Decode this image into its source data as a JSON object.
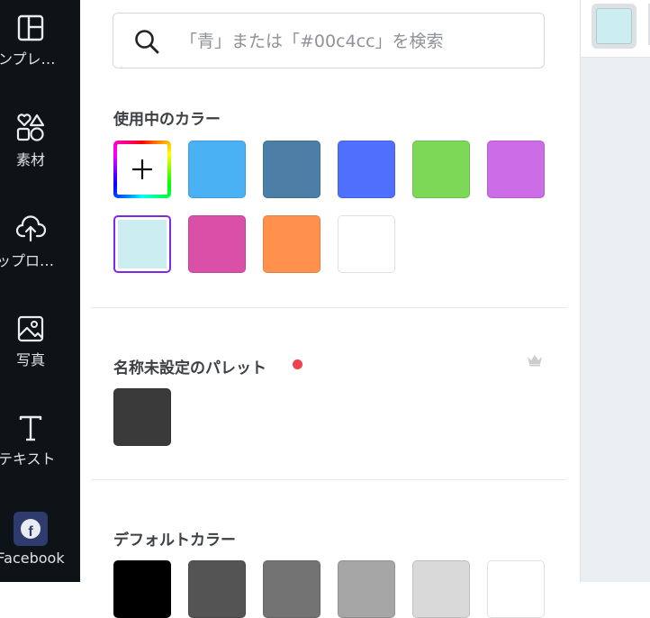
{
  "sidebar": {
    "items": [
      {
        "key": "templates",
        "label": "ンプレ…",
        "icon": "templates-icon"
      },
      {
        "key": "elements",
        "label": "素材",
        "icon": "shapes-icon"
      },
      {
        "key": "uploads",
        "label": "ップロ…",
        "icon": "cloud-upload-icon"
      },
      {
        "key": "photos",
        "label": "写真",
        "icon": "image-icon"
      },
      {
        "key": "text",
        "label": "テキスト",
        "icon": "text-icon"
      },
      {
        "key": "facebook",
        "label": "Facebook",
        "icon": "facebook-icon"
      }
    ]
  },
  "search": {
    "placeholder": "「青」または「#00c4cc」を検索",
    "value": ""
  },
  "in_use": {
    "title": "使用中のカラー",
    "swatches": [
      "#4ab1f5",
      "#4d7fa6",
      "#4f6ffd",
      "#7ed857",
      "#cd6ce7",
      "#cdeef0",
      "#da50a8",
      "#ff914d",
      "#ffffff"
    ],
    "selected": "#cdeef0"
  },
  "palette": {
    "title": "名称未設定のパレット",
    "dot_color": "#f03f4f",
    "swatches": [
      "#3a3a3a"
    ]
  },
  "defaults": {
    "title": "デフォルトカラー",
    "swatches": [
      "#000000",
      "#545454",
      "#737373",
      "#a6a6a6",
      "#d9d9d9",
      "#ffffff"
    ]
  },
  "current_color": "#cdeef0"
}
